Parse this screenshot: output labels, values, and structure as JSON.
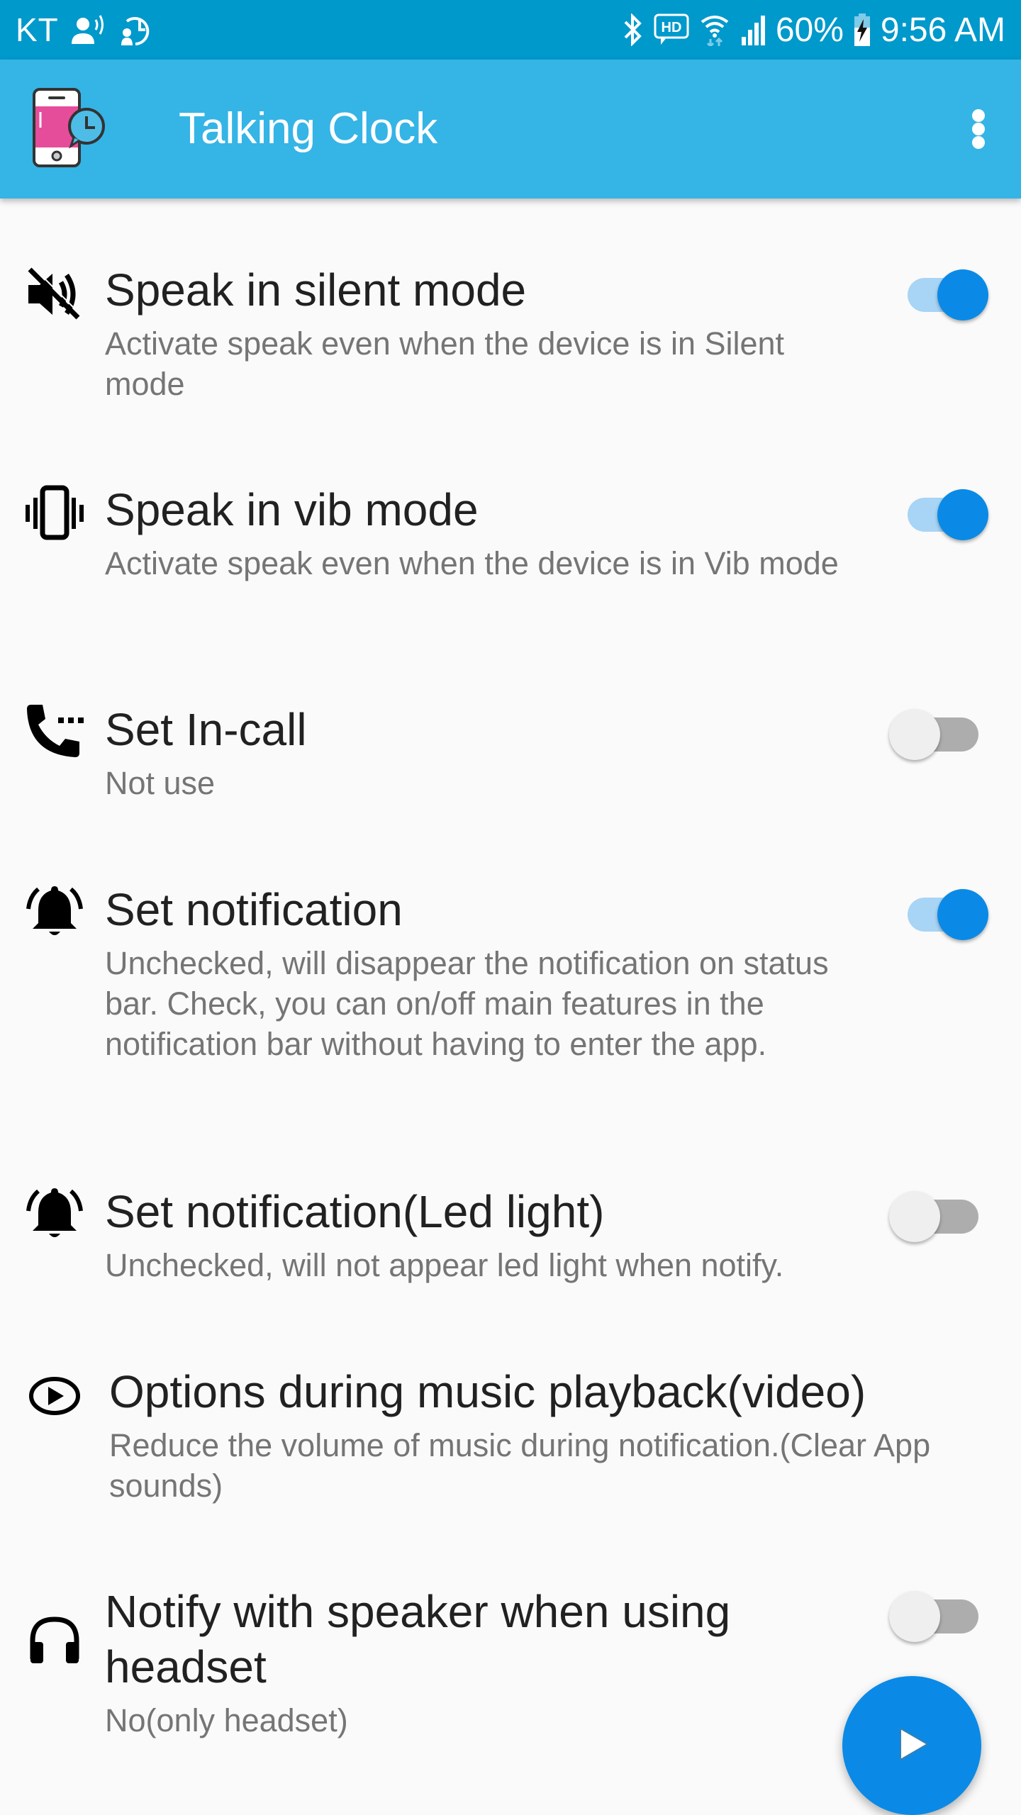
{
  "status_bar": {
    "carrier": "KT",
    "battery_percent": "60%",
    "time": "9:56 AM",
    "icons": [
      "contact-voice-icon",
      "contact-history-icon",
      "bluetooth-icon",
      "hd-voice-icon",
      "wifi-icon",
      "signal-icon",
      "battery-charging-icon"
    ]
  },
  "app_bar": {
    "title": "Talking Clock",
    "logo": "talking-clock-logo",
    "overflow_icon": "more-vert-icon"
  },
  "preferences": [
    {
      "icon": "volume-off-icon",
      "title": "Speak in silent mode",
      "summary": "Activate speak even when the device is in Silent mode",
      "enabled": true
    },
    {
      "icon": "vibration-icon",
      "title": "Speak in vib mode",
      "summary": "Activate speak even when the device is in Vib mode",
      "enabled": true
    },
    {
      "icon": "phone-in-call-icon",
      "title": "Set In-call",
      "summary": "Not use",
      "enabled": false
    },
    {
      "icon": "notification-bell-icon",
      "title": "Set notification",
      "summary": "Unchecked, will disappear the notification on status bar. Check, you can on/off main features in the notification bar without having to enter the app.",
      "enabled": true
    },
    {
      "icon": "notification-bell-icon",
      "title": "Set notification(Led light)",
      "summary": "Unchecked, will not appear led light when notify.",
      "enabled": false
    },
    {
      "icon": "play-circle-icon",
      "title": "Options during music playback(video)",
      "summary": "Reduce the volume of music during notification.(Clear App sounds)"
    },
    {
      "icon": "headset-icon",
      "title": "Notify with speaker when using headset",
      "summary": "No(only headset)",
      "enabled": false
    }
  ],
  "fab": {
    "icon": "play-icon"
  },
  "colors": {
    "status_bar": "#0099cc",
    "app_bar": "#35b4e6",
    "accent": "#0a8ae6",
    "background": "#fafafa"
  }
}
